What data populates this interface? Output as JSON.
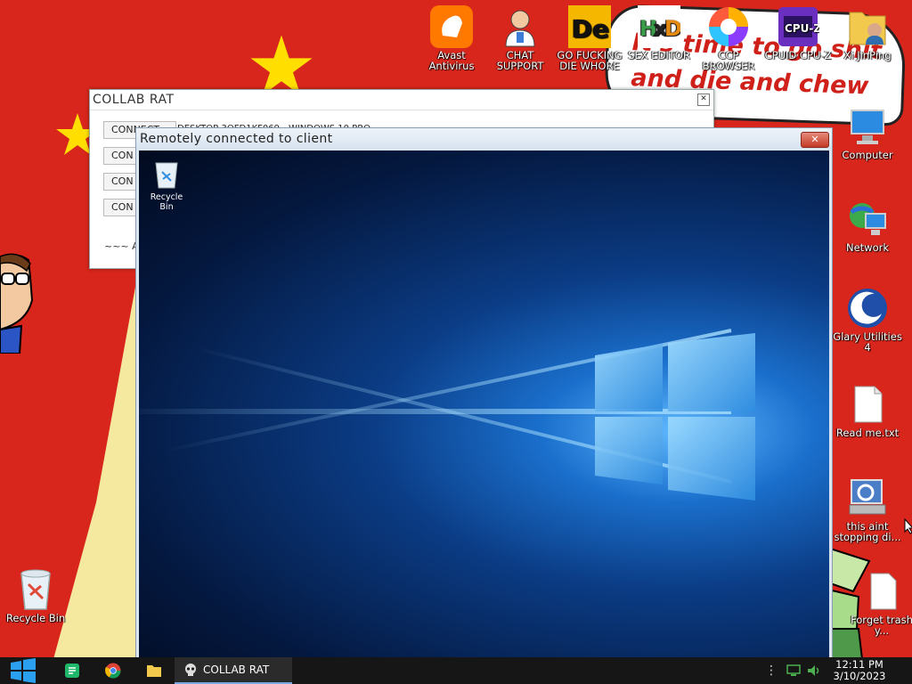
{
  "desktop": {
    "banner_text": "It's time to go shit and die and chew pillin",
    "top_icons": [
      {
        "name": "avast-icon",
        "label": "Avast Antivirus"
      },
      {
        "name": "chat-support-icon",
        "label": "CHAT SUPPORT"
      },
      {
        "name": "die-icon",
        "label": "GO FUCKING DIE WHORE"
      },
      {
        "name": "hxd-icon",
        "label": "SEX EDITOR"
      },
      {
        "name": "ccp-browser-icon",
        "label": "CCP BROWSER"
      },
      {
        "name": "cpuz-icon",
        "label": "CPUID CPU-Z"
      },
      {
        "name": "xiunping-icon",
        "label": "Xi JinPing"
      }
    ],
    "right_icons": [
      {
        "name": "computer-icon",
        "label": "Computer"
      },
      {
        "name": "network-icon",
        "label": "Network"
      },
      {
        "name": "glary-icon",
        "label": "Glary Utilities 4"
      },
      {
        "name": "text-file-icon",
        "label": "Read me.txt"
      },
      {
        "name": "scanner-icon",
        "label": "this aint stopping di..."
      },
      {
        "name": "file-icon",
        "label": "Forget trash y..."
      }
    ],
    "recycle_bin": "Recycle Bin"
  },
  "rat_window": {
    "title": "COLLAB RAT",
    "connect_label": "CONNECT",
    "connect_buttons_partial": [
      "CON",
      "CON",
      "CON"
    ],
    "info": "DESKTOP-3OFD1KF069 - WINDOWS 10 PRO",
    "footer": "~~~ AV"
  },
  "remote_window": {
    "title": "Remotely connected to client",
    "close_symbol": "✕",
    "recycle_bin": "Recycle Bin"
  },
  "taskbar": {
    "active_app": "COLLAB RAT",
    "time": "12:11 PM",
    "date": "3/10/2023"
  },
  "colors": {
    "wallpaper_red": "#d8261c",
    "star_yellow": "#ffde00",
    "taskbar": "#161616"
  }
}
